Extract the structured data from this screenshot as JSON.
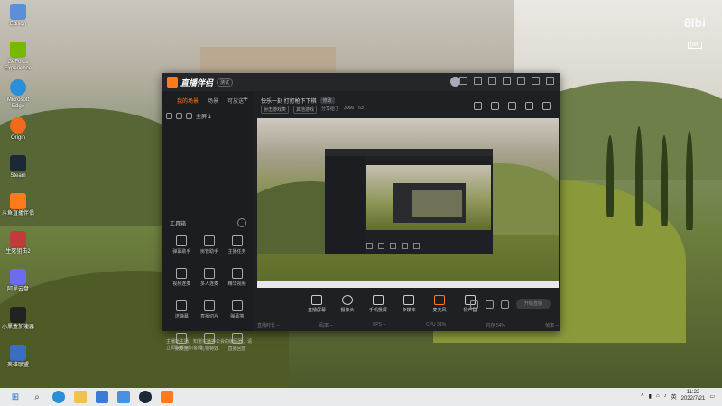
{
  "desktop": {
    "watermark": "8lbi",
    "watermark_sub": "[88]",
    "icons": [
      {
        "label": "Edison",
        "color": "#5b8fd6"
      },
      {
        "label": "GeForce Experience",
        "color": "#76b900"
      },
      {
        "label": "Microsoft Edge",
        "color": "#2a8fd6"
      },
      {
        "label": "Origin",
        "color": "#f26a1b"
      },
      {
        "label": "Steam",
        "color": "#1b2838"
      },
      {
        "label": "斗鱼直播伴侣",
        "color": "#ff7a1a"
      },
      {
        "label": "生死狙击2",
        "color": "#c23a3a"
      },
      {
        "label": "阿里云盘",
        "color": "#6b6cf0"
      },
      {
        "label": "小黑盒加速器",
        "color": "#222222"
      },
      {
        "label": "英雄联盟",
        "color": "#3a6fc0"
      }
    ]
  },
  "app": {
    "name": "直播伴侣",
    "badge": "测试",
    "left_tabs": [
      "我的场景",
      "场景",
      "可放送"
    ],
    "scene_name": "全屏 1",
    "tools_title": "工具箱",
    "tools": [
      "弹幕助手",
      "房管助手",
      "主播任务",
      "视频连麦",
      "多人连麦",
      "精华视频",
      "送弹幕",
      "直播切片",
      "弹幕墙",
      "朋友圈",
      "礼物特效",
      "直播回放"
    ],
    "live_title": "快乐一刻 打打枪下下棋",
    "live_title_tag": "修改",
    "meta_chips": [
      "射击游戏类",
      "其他游戏"
    ],
    "meta_text": [
      "分享给了",
      "3906",
      "63"
    ],
    "bottom_tools": [
      "直播屏幕",
      "摄像头",
      "手机投屏",
      "多媒体",
      "麦克风",
      "扬声器"
    ],
    "start_button": "开始直播",
    "status": [
      "直播时长 --",
      "码率 --",
      "FPS --",
      "CPU 31%",
      "内存 54%",
      "帧率 --"
    ],
    "notice": "主播新主播，知道实播等公会的编码器，请立即联系专职客服"
  },
  "taskbar": {
    "items": [
      "start",
      "search",
      "edge",
      "folder",
      "store",
      "mail",
      "steam",
      "douyu"
    ],
    "tray_lang": "英",
    "time": "11:22",
    "date": "2022/7/21"
  }
}
